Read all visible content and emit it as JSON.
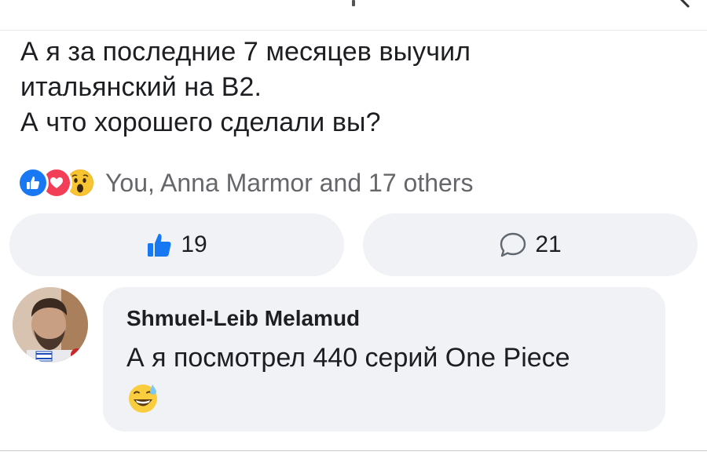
{
  "post": {
    "text_lines": [
      "А я за последние 7 месяцев выучил",
      "итальянский на B2.",
      "А что хорошего сделали вы?"
    ]
  },
  "reactions": {
    "icons": [
      "like-icon",
      "love-icon",
      "wow-icon"
    ],
    "summary": "You, Anna Marmor and 17 others"
  },
  "actions": {
    "like_count": "19",
    "comment_count": "21"
  },
  "comment": {
    "author": "Shmuel-Leib Melamud",
    "text": "А я посмотрел 440 серий One Piece",
    "emoji": "sweat-smile-emoji"
  },
  "colors": {
    "like_blue": "#1877f2",
    "love_red": "#f33e58",
    "wow_yellow": "#f7b125",
    "bubble_gray": "#f0f2f5",
    "secondary_text": "#65676b"
  }
}
